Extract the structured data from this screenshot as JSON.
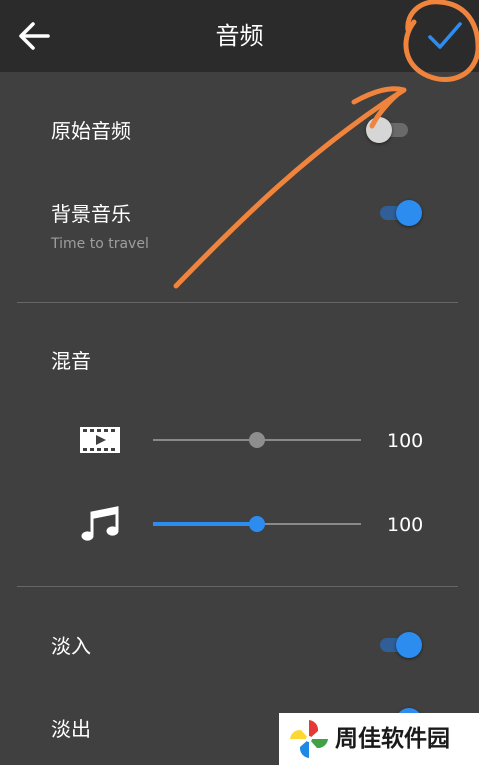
{
  "header": {
    "title": "音频",
    "back_icon": "arrow-left-icon",
    "confirm_icon": "checkmark-icon",
    "accent_color": "#2d8cf0"
  },
  "settings": {
    "original_audio": {
      "label": "原始音频",
      "enabled": false
    },
    "background_music": {
      "label": "背景音乐",
      "subtitle": "Time to travel",
      "enabled": true
    },
    "mix": {
      "label": "混音",
      "video_volume": {
        "icon": "film-icon",
        "value": "100",
        "level": 0.5
      },
      "music_volume": {
        "icon": "music-note-icon",
        "value": "100",
        "level": 0.5
      }
    },
    "fade_in": {
      "label": "淡入",
      "enabled": true
    },
    "fade_out": {
      "label": "淡出",
      "enabled": true
    }
  },
  "watermark": {
    "text": "周佳软件园",
    "logo": "pinwheel-logo"
  }
}
